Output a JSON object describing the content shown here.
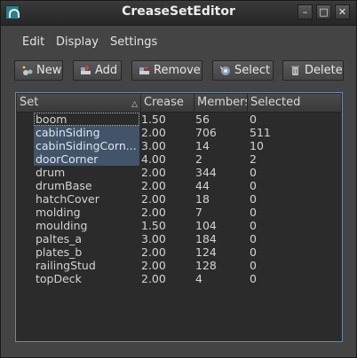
{
  "window": {
    "title": "CreaseSetEditor",
    "app_icon": "maya-icon",
    "controls": {
      "minimize": "–",
      "maximize": "□",
      "close": "✕"
    }
  },
  "menubar": {
    "items": [
      "Edit",
      "Display",
      "Settings"
    ]
  },
  "toolbar": {
    "new_label": "New",
    "add_label": "Add",
    "remove_label": "Remove",
    "select_label": "Select",
    "delete_label": "Delete"
  },
  "table": {
    "columns": [
      "Set",
      "Crease",
      "Members",
      "Selected"
    ],
    "rows": [
      {
        "set": "boom",
        "crease": "1.50",
        "members": "56",
        "selected": "0",
        "state": "focus"
      },
      {
        "set": "cabinSiding",
        "crease": "2.00",
        "members": "706",
        "selected": "511",
        "state": "selected"
      },
      {
        "set": "cabinSidingCorn...",
        "crease": "3.00",
        "members": "14",
        "selected": "10",
        "state": "selected"
      },
      {
        "set": "doorCorner",
        "crease": "4.00",
        "members": "2",
        "selected": "2",
        "state": "selected"
      },
      {
        "set": "drum",
        "crease": "2.00",
        "members": "344",
        "selected": "0",
        "state": ""
      },
      {
        "set": "drumBase",
        "crease": "2.00",
        "members": "44",
        "selected": "0",
        "state": ""
      },
      {
        "set": "hatchCover",
        "crease": "2.00",
        "members": "18",
        "selected": "0",
        "state": ""
      },
      {
        "set": "molding",
        "crease": "2.00",
        "members": "7",
        "selected": "0",
        "state": ""
      },
      {
        "set": "moulding",
        "crease": "1.50",
        "members": "104",
        "selected": "0",
        "state": ""
      },
      {
        "set": "paltes_a",
        "crease": "3.00",
        "members": "184",
        "selected": "0",
        "state": ""
      },
      {
        "set": "plates_b",
        "crease": "2.00",
        "members": "124",
        "selected": "0",
        "state": ""
      },
      {
        "set": "railingStud",
        "crease": "2.00",
        "members": "128",
        "selected": "0",
        "state": ""
      },
      {
        "set": "topDeck",
        "crease": "2.00",
        "members": "4",
        "selected": "0",
        "state": ""
      }
    ]
  },
  "colors": {
    "selection": "#42536a",
    "table_border": "#6a8aa6",
    "background": "#444444"
  }
}
